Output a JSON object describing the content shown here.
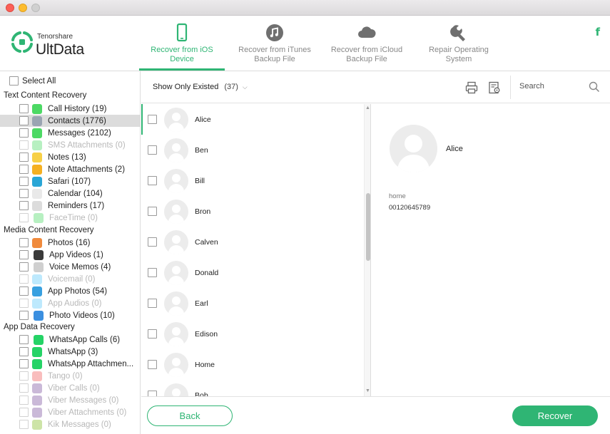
{
  "header": {
    "brand_small": "Tenorshare",
    "brand_big": "UltData",
    "social": "f",
    "accent": "#2fb574",
    "tabs": [
      {
        "label": "Recover from iOS Device",
        "icon": "phone-icon",
        "active": true
      },
      {
        "label": "Recover from iTunes Backup File",
        "icon": "music-icon",
        "active": false
      },
      {
        "label": "Recover from iCloud Backup File",
        "icon": "cloud-icon",
        "active": false
      },
      {
        "label": "Repair Operating System",
        "icon": "wrench-icon",
        "active": false
      }
    ]
  },
  "sidebar": {
    "select_all": "Select All",
    "categories": {
      "text": "Text Content Recovery",
      "media": "Media Content Recovery",
      "app": "App Data Recovery"
    },
    "items": [
      {
        "label": "Call History (19)",
        "icon": "phone-app-icon",
        "color": "#4cd964"
      },
      {
        "label": "Contacts (1776)",
        "icon": "contacts-icon",
        "color": "#9aa4b2",
        "selected": true
      },
      {
        "label": "Messages (2102)",
        "icon": "messages-icon",
        "color": "#4cd964"
      },
      {
        "label": "SMS Attachments (0)",
        "icon": "sms-attachment-icon",
        "color": "#4cd964",
        "disabled": true
      },
      {
        "label": "Notes (13)",
        "icon": "notes-icon",
        "color": "#f7d046"
      },
      {
        "label": "Note Attachments (2)",
        "icon": "note-attachment-icon",
        "color": "#f5b021"
      },
      {
        "label": "Safari (107)",
        "icon": "safari-icon",
        "color": "#2aa6d6"
      },
      {
        "label": "Calendar (104)",
        "icon": "calendar-icon",
        "color": "#e9e9e9"
      },
      {
        "label": "Reminders (17)",
        "icon": "reminders-icon",
        "color": "#dcdcdc"
      },
      {
        "label": "FaceTime (0)",
        "icon": "facetime-icon",
        "color": "#4cd964",
        "disabled": true
      },
      {
        "label": "Photos (16)",
        "icon": "photos-icon",
        "color": "#f08a3c"
      },
      {
        "label": "App Videos (1)",
        "icon": "app-videos-icon",
        "color": "#3a3a3a"
      },
      {
        "label": "Voice Memos (4)",
        "icon": "voice-memos-icon",
        "color": "#cfcfcf"
      },
      {
        "label": "Voicemail (0)",
        "icon": "voicemail-icon",
        "color": "#5ac8fa",
        "disabled": true
      },
      {
        "label": "App Photos (54)",
        "icon": "app-photos-icon",
        "color": "#38a0e0"
      },
      {
        "label": "App Audios (0)",
        "icon": "app-audios-icon",
        "color": "#5ac8fa",
        "disabled": true
      },
      {
        "label": "Photo Videos (10)",
        "icon": "photo-videos-icon",
        "color": "#3b8fe0"
      },
      {
        "label": "WhatsApp Calls (6)",
        "icon": "whatsapp-calls-icon",
        "color": "#25d366"
      },
      {
        "label": "WhatsApp (3)",
        "icon": "whatsapp-icon",
        "color": "#25d366"
      },
      {
        "label": "WhatsApp Attachmen...",
        "icon": "whatsapp-attachment-icon",
        "color": "#25d366"
      },
      {
        "label": "Tango (0)",
        "icon": "tango-icon",
        "color": "#f05a5a",
        "disabled": true
      },
      {
        "label": "Viber Calls (0)",
        "icon": "viber-calls-icon",
        "color": "#7b519d",
        "disabled": true
      },
      {
        "label": "Viber Messages (0)",
        "icon": "viber-messages-icon",
        "color": "#7b519d",
        "disabled": true
      },
      {
        "label": "Viber Attachments (0)",
        "icon": "viber-attachment-icon",
        "color": "#7b519d",
        "disabled": true
      },
      {
        "label": "Kik Messages (0)",
        "icon": "kik-icon",
        "color": "#82bc23",
        "disabled": true
      }
    ]
  },
  "toolbar": {
    "filter_label": "Show Only Existed",
    "filter_count": "(37)",
    "search_placeholder": "Search"
  },
  "contacts": [
    "Alice",
    "Ben",
    "Bill",
    "Bron",
    "Calven",
    "Donald",
    "Earl",
    "Edison",
    "Home",
    "Bob"
  ],
  "detail": {
    "name": "Alice",
    "phone_label": "home",
    "phone_value": "00120645789"
  },
  "footer": {
    "back_label": "Back",
    "recover_label": "Recover"
  }
}
